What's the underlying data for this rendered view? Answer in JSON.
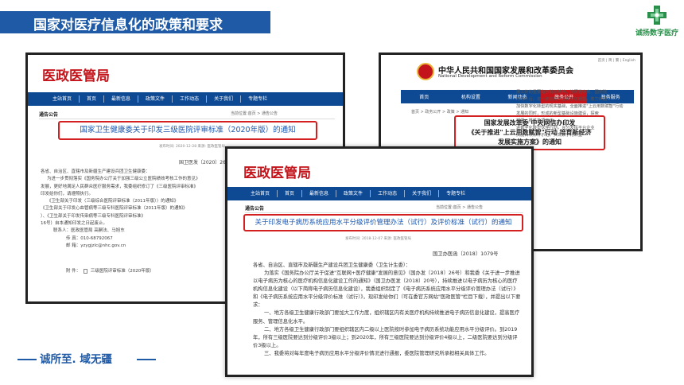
{
  "page": {
    "title": "国家对医疗信息化的政策和要求",
    "brand_name": "诚扬数字医疗",
    "slogan": "诚所至. 域无疆"
  },
  "shot1": {
    "logo": "医政医管局",
    "nav": [
      "主站首页",
      "首页",
      "最新信息",
      "政策文件",
      "工作动态",
      "关于我们",
      "专题专栏"
    ],
    "crumb": "当前位置:首页 > 通告公告",
    "section": "通告公告",
    "headline": "国家卫生健康委关于印发三级医院评审标准（2020年版）的通知",
    "meta": "发布时间: 2020-12-28  来源: 医政医管局",
    "doc_no": "国卫医发〔2020〕26号",
    "body": [
      "各省、自治区、直辖市及新疆生产建设兵团卫生健康委：",
      "为进一步贯彻落实《国务院办公厅关于加强三级公立医院绩效考核工作的意见》",
      "发展，更好地满足人民群众医疗服务需求，我委组织修订了《三级医院评审标准》",
      "印发给你们，请遵照执行。",
      "《卫生部关于印发〈三级综合医院评审标准（2011年版）〉的通知》",
      "《卫生部关于印发心血管病等三级专科医院评审标准（2011年版）的通知》",
      "）、《卫生部关于印发传染病等三级专科医院评审标准》",
      "16号）自本通知印发之日起废止。",
      "联系人：医政医管局  高嗣法、马旭东",
      "传  真：010-68792067",
      "邮  箱：yzygjzlc@nhc.gov.cn"
    ],
    "attachment_label": "附  件：",
    "attachment": "三级医院评审标准（2020年版）"
  },
  "shot2": {
    "org_cn": "中华人民共和国国家发展和改革委员会",
    "org_en": "National Development and Reform Commission",
    "toplinks": "首页 | 简 | 繁 | English",
    "nav": [
      "首页",
      "机构设置",
      "新闻动态",
      "政务公开",
      "政务服务"
    ],
    "active_nav": 3,
    "crumb": "首页 > 政务公开 > 政策 > 通知",
    "headline_lines": [
      "国家发展改革委 中央网信办印发",
      "《关于推进\"上云用数赋智\"行动 培育新经济",
      "发展实施方案》的通知"
    ],
    "right_body": [
      "展工作的重要指示批示精神，按照党中央、国务院",
      "用与平台，进一步加快产业数字化转型，着力推进",
      "加快数字化转型的现实基础，全面推进\"上云用数赋智\"行动",
      "发展的同时，形成的新型基础设施建设，探索",
      "部署，推进各项工作。",
      "",
      "",
      "",
      "进数字化转型伙伴行动，充分发挥平台企业",
      "实施百项标杆示范，实现数字化转型"
    ]
  },
  "shot3": {
    "logo": "医政医管局",
    "nav": [
      "主站首页",
      "首页",
      "最新信息",
      "政策文件",
      "工作动态",
      "关于我们",
      "专题专栏"
    ],
    "crumb": "当前位置:首页 > 通告公告",
    "section": "通告公告",
    "headline": "关于印发电子病历系统应用水平分级评价管理办法（试行）及评价标准（试行）的通知",
    "meta": "发布时间: 2018-12-07  来源: 医政医管局",
    "doc_no": "国卫办医函〔2018〕1079号",
    "body": [
      "各省、自治区、直辖市及新疆生产建设兵团卫生健康委（卫生计生委）：",
      "为落实《国务院办公厅关于促进\"互联网+医疗健康\"发展的意见》（国办发〔2018〕26号）和我委《关于进一步推进以电子病历为核心的医疗机构信息化建设工作的通知》（国卫办医发〔2018〕20号），持续推进以电子病历为核心的医疗机构信息化建设（以下简称电子病历信息化建设），我委组织制定了《电子病历系统应用水平分级评价管理办法（试行）》和《电子病历系统应用水平分级评价标准（试行）》，现印发给你们（可在委官方网站\"医政医管\"栏目下载），并提出以下要求：",
      "一、地方各级卫生健康行政部门要加大工作力度，组织辖区内有关医疗机构持续推进电子病历信息化建设，提高医疗服务、管理信息化水平。",
      "二、地方各级卫生健康行政部门要组织辖区内二级以上医院按时参加电子病历系统功能应用水平分级评价。到2019年，所有三级医院要达到分级评价3级以上；到2020年，所有三级医院要达到分级评价4级以上，二级医院要达到分级评价3级以上。",
      "三、我委将对每年度电子病历应用水平分级评价情况进行通报，委医院管理研究所承担相关具体工作。"
    ]
  },
  "colors": {
    "primary_blue": "#1f5aa6",
    "nav_blue": "#0e4a94",
    "highlight_red": "#d42020",
    "logo_red": "#c4141b",
    "brand_green": "#2a8f4a"
  }
}
